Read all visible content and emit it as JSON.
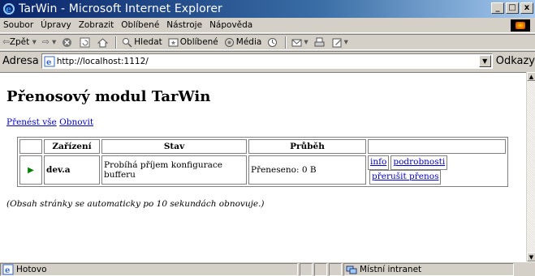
{
  "window": {
    "title": "TarWin - Microsoft Internet Explorer",
    "minimize_label": "_",
    "maximize_label": "□",
    "close_label": "x"
  },
  "menu": {
    "items": [
      {
        "label": "Soubor"
      },
      {
        "label": "Úpravy"
      },
      {
        "label": "Zobrazit"
      },
      {
        "label": "Oblíbené"
      },
      {
        "label": "Nástroje"
      },
      {
        "label": "Nápověda"
      }
    ]
  },
  "toolbar": {
    "back_label": "Zpět",
    "search_label": "Hledat",
    "favorites_label": "Oblíbené",
    "media_label": "Média"
  },
  "address": {
    "label": "Adresa",
    "url": "http://localhost:1112/",
    "go_label": "Odkazy"
  },
  "page": {
    "heading": "Přenosový modul TarWin",
    "transfer_all": "Přenést vše",
    "refresh": "Obnovit",
    "table": {
      "headers": [
        "",
        "Zařízení",
        "Stav",
        "Průběh",
        ""
      ],
      "rows": [
        {
          "device": "dev.a",
          "status": "Probíhá příjem konfigurace bufferu",
          "progress": "Přeneseno: 0 B",
          "action_info": "info",
          "action_details": "podrobnosti",
          "action_abort": "přerušit přenos"
        }
      ]
    },
    "note": "(Obsah stránky se automaticky po 10 sekundách obnovuje.)"
  },
  "status": {
    "text": "Hotovo",
    "zone": "Místní intranet"
  },
  "colors": {
    "link": "#0000cc",
    "titlebar_start": "#0a246a",
    "play": "#008000"
  }
}
